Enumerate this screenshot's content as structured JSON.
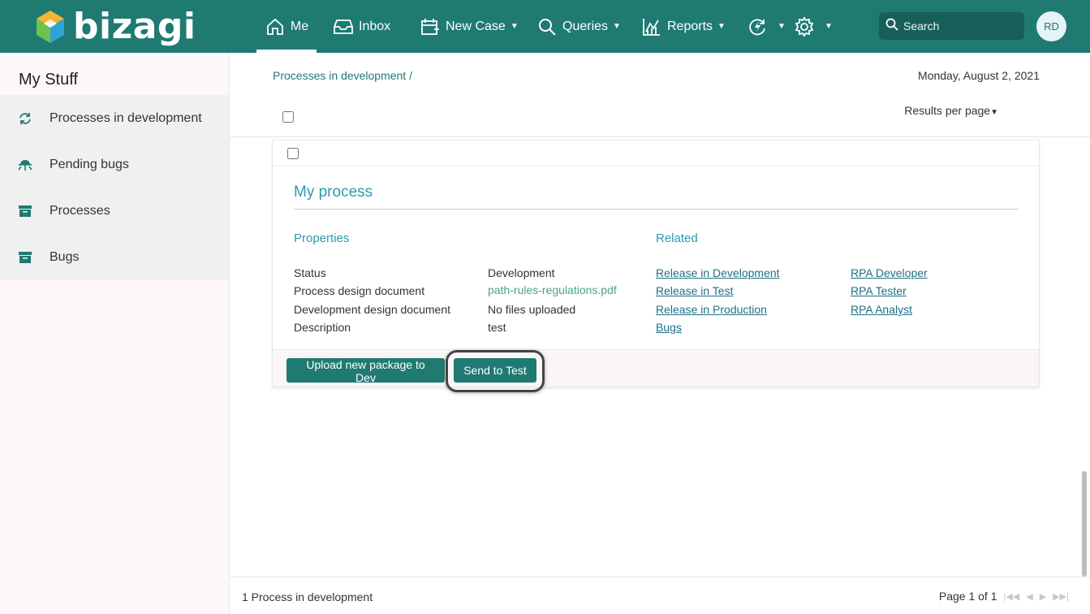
{
  "app": {
    "logo_text": "bizagi",
    "logo_colors": [
      "#6cc24a",
      "#2ea3d6",
      "#f5b335",
      "#1f7a72"
    ]
  },
  "nav": {
    "me": {
      "label": "Me",
      "icon": "home-icon"
    },
    "inbox": {
      "label": "Inbox",
      "icon": "inbox-icon"
    },
    "new_case": {
      "label": "New Case",
      "icon": "new-case-icon"
    },
    "queries": {
      "label": "Queries",
      "icon": "search-icon"
    },
    "reports": {
      "label": "Reports",
      "icon": "reports-icon"
    },
    "automation": {
      "label": "",
      "icon": "lightning-refresh-icon"
    },
    "settings": {
      "label": "",
      "icon": "gear-icon"
    },
    "search_placeholder": "Search",
    "avatar_initials": "RD",
    "active": "Me"
  },
  "sidebar": {
    "title": "My Stuff",
    "items": [
      {
        "label": "Processes in development",
        "icon": "refresh-icon"
      },
      {
        "label": "Pending bugs",
        "icon": "bug-icon"
      },
      {
        "label": "Processes",
        "icon": "archive-icon"
      },
      {
        "label": "Bugs",
        "icon": "archive-icon"
      }
    ]
  },
  "main": {
    "breadcrumb": "Processes in development /",
    "date": "Monday, August 2, 2021",
    "results_per_page": "Results per page",
    "card": {
      "title": "My process",
      "properties_title": "Properties",
      "related_title": "Related",
      "properties": [
        {
          "label": "Status",
          "value": "Development"
        },
        {
          "label": "Process design document",
          "value": "path-rules-regulations.pdf"
        },
        {
          "label": "Development design document",
          "value": "No files uploaded"
        },
        {
          "label": "Description",
          "value": "test"
        }
      ],
      "related_col1": [
        "Release in Development",
        "Release in Test",
        "Release in Production",
        "Bugs"
      ],
      "related_col2": [
        "RPA Developer",
        "RPA Tester",
        "RPA Analyst"
      ],
      "buttons": {
        "upload": "Upload new package to Dev",
        "send_to_test": "Send to Test"
      }
    },
    "footer": {
      "count": "1 Process in development",
      "page": "Page 1 of 1"
    }
  },
  "colors": {
    "primary": "#1f7a72",
    "accent_title": "#2b9aad",
    "link": "#1f6f87"
  }
}
